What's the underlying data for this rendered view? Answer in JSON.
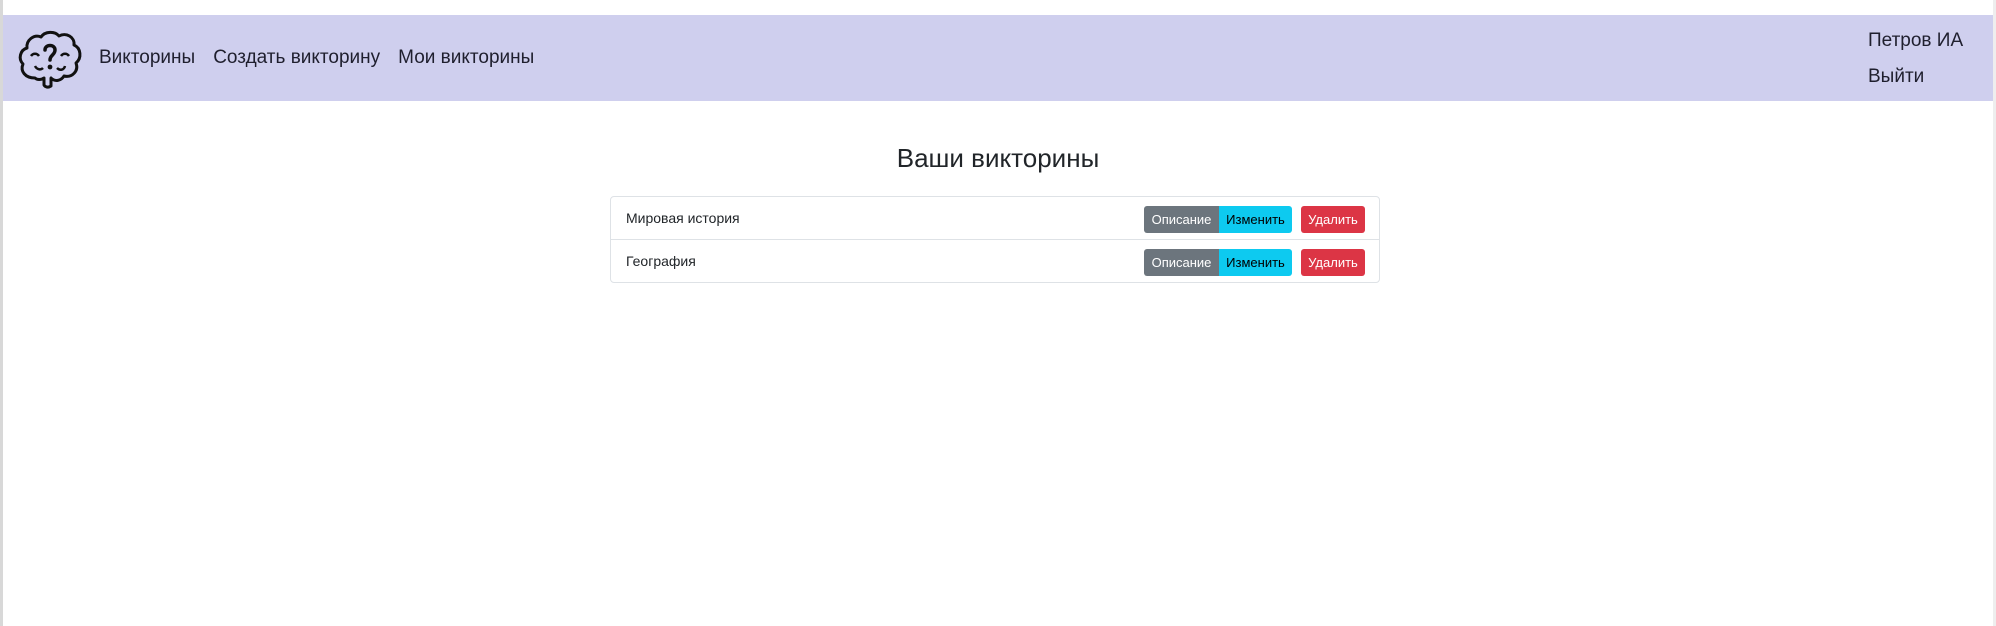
{
  "navbar": {
    "logo_icon": "brain-question-icon",
    "links": [
      {
        "label": "Викторины"
      },
      {
        "label": "Создать викторину"
      },
      {
        "label": "Мои викторины"
      }
    ],
    "user_name": "Петров ИА",
    "logout_label": "Выйти",
    "background_color": "#cfcfee"
  },
  "main": {
    "title": "Ваши викторины",
    "quizzes": [
      {
        "name": "Мировая история",
        "describe_label": "Описание",
        "edit_label": "Изменить",
        "delete_label": "Удалить"
      },
      {
        "name": "География",
        "describe_label": "Описание",
        "edit_label": "Изменить",
        "delete_label": "Удалить"
      }
    ]
  },
  "colors": {
    "describe_button": "#6c757d",
    "edit_button": "#0dcaf0",
    "delete_button": "#dc3545"
  }
}
